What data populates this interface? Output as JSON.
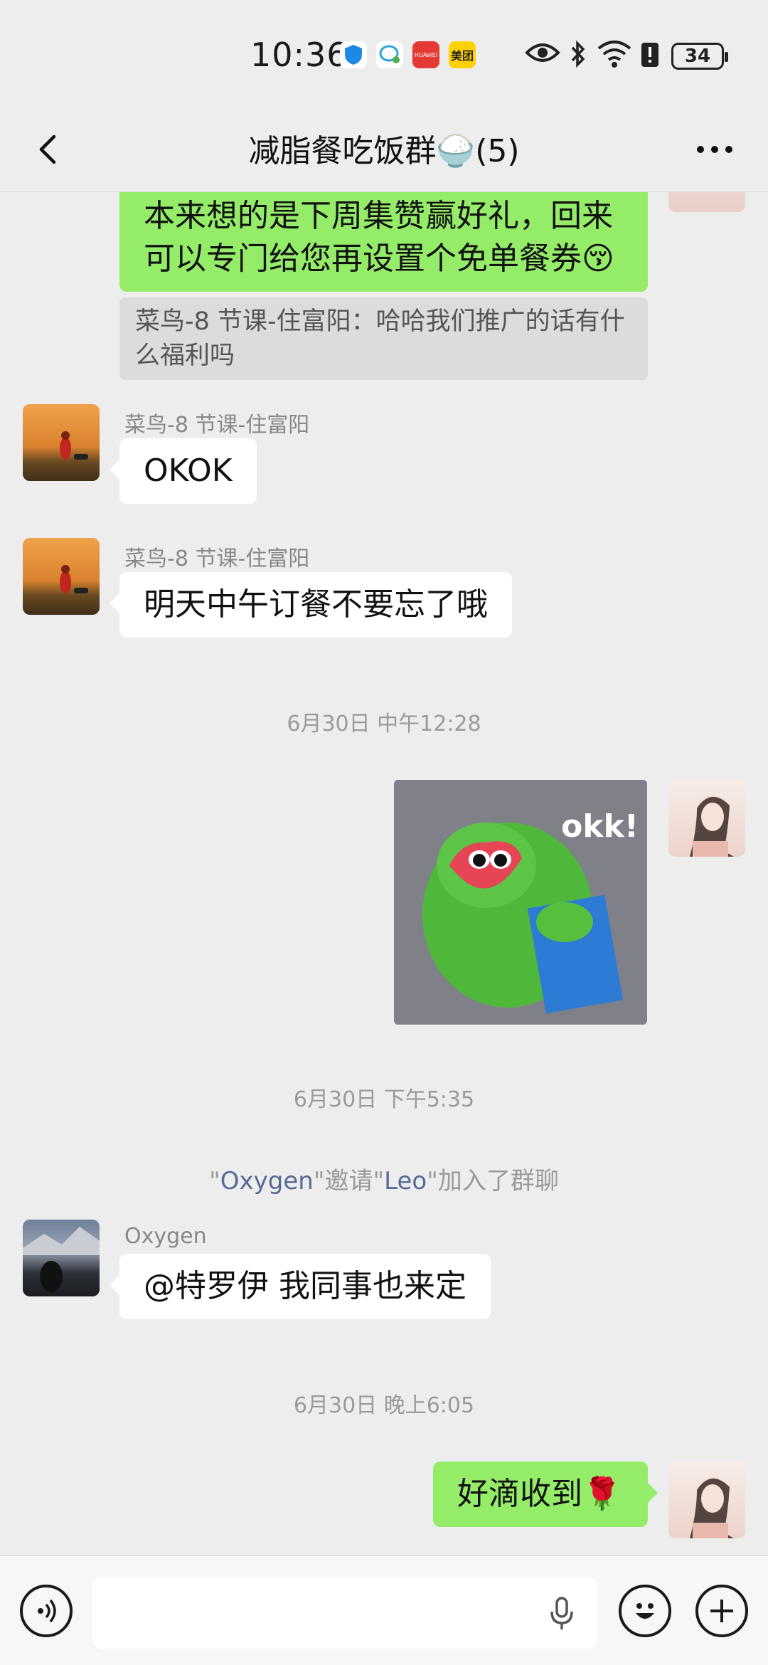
{
  "status_bar": {
    "time": "10:36",
    "battery": "34",
    "apps": [
      {
        "name": "shield-app-icon",
        "label": ""
      },
      {
        "name": "bubble-app-icon",
        "label": ""
      },
      {
        "name": "huawei-store-icon",
        "label": "HUAWEI"
      },
      {
        "name": "meituan-icon",
        "label": "美团"
      }
    ]
  },
  "header": {
    "title": "减脂餐吃饭群🍚(5)",
    "back_icon": "chevron-left-icon",
    "more_icon": "more-dots-icon",
    "more_label": "···"
  },
  "messages": {
    "top_green": "本来想的是下周集赞赢好礼，回来可以专门给您再设置个免单餐券😚",
    "top_quote": "菜鸟-8 节课-住富阳：哈哈我们推广的话有什么福利吗",
    "m1_sender": "菜鸟-8 节课-住富阳",
    "m1_text": "OKOK",
    "m2_sender": "菜鸟-8 节课-住富阳",
    "m2_text": "明天中午订餐不要忘了哦",
    "time1": "6月30日 中午12:28",
    "sticker_text": "okk!",
    "time2": "6月30日 下午5:35",
    "system_q1": "\"",
    "system_name1": "Oxygen",
    "system_mid": "\"邀请\"",
    "system_name2": "Leo",
    "system_end": "\"加入了群聊",
    "m3_sender": "Oxygen",
    "m3_text": "@特罗伊  我同事也来定",
    "time3": "6月30日 晚上6:05",
    "m4_text": "好滴收到🌹"
  },
  "input_bar": {
    "voice_icon": "voice-icon",
    "mic_icon": "mic-icon",
    "emoji_icon": "emoji-icon",
    "plus_icon": "plus-icon",
    "placeholder": ""
  },
  "colors": {
    "background": "#ededed",
    "green_bubble": "#95ec69",
    "white_bubble": "#ffffff",
    "link": "#576b95"
  }
}
